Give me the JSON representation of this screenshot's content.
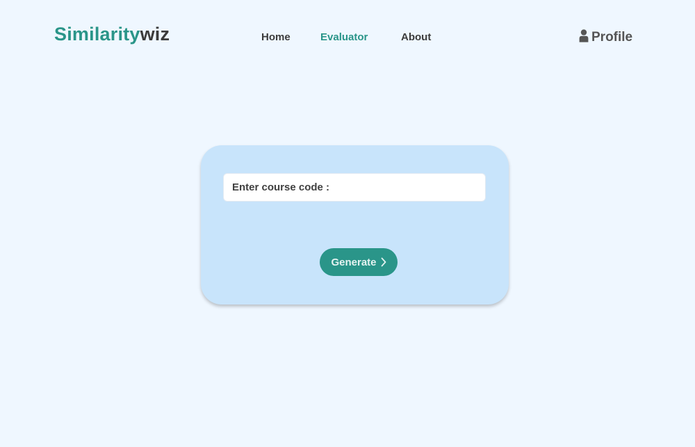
{
  "logo": {
    "part1": "Similarity",
    "part2": "wiz"
  },
  "nav": {
    "home": "Home",
    "evaluator": "Evaluator",
    "about": "About",
    "active": "Evaluator"
  },
  "profile": {
    "label": "Profile",
    "icon": "user-icon"
  },
  "form": {
    "course_code_label": "Enter course code :",
    "course_code_value": "",
    "generate_label": "Generate",
    "generate_icon": "chevron-right-icon"
  },
  "colors": {
    "accent": "#2a9589",
    "background": "#eff7ff",
    "card": "#c8e4fb",
    "text_dark": "#3c3c3c"
  }
}
